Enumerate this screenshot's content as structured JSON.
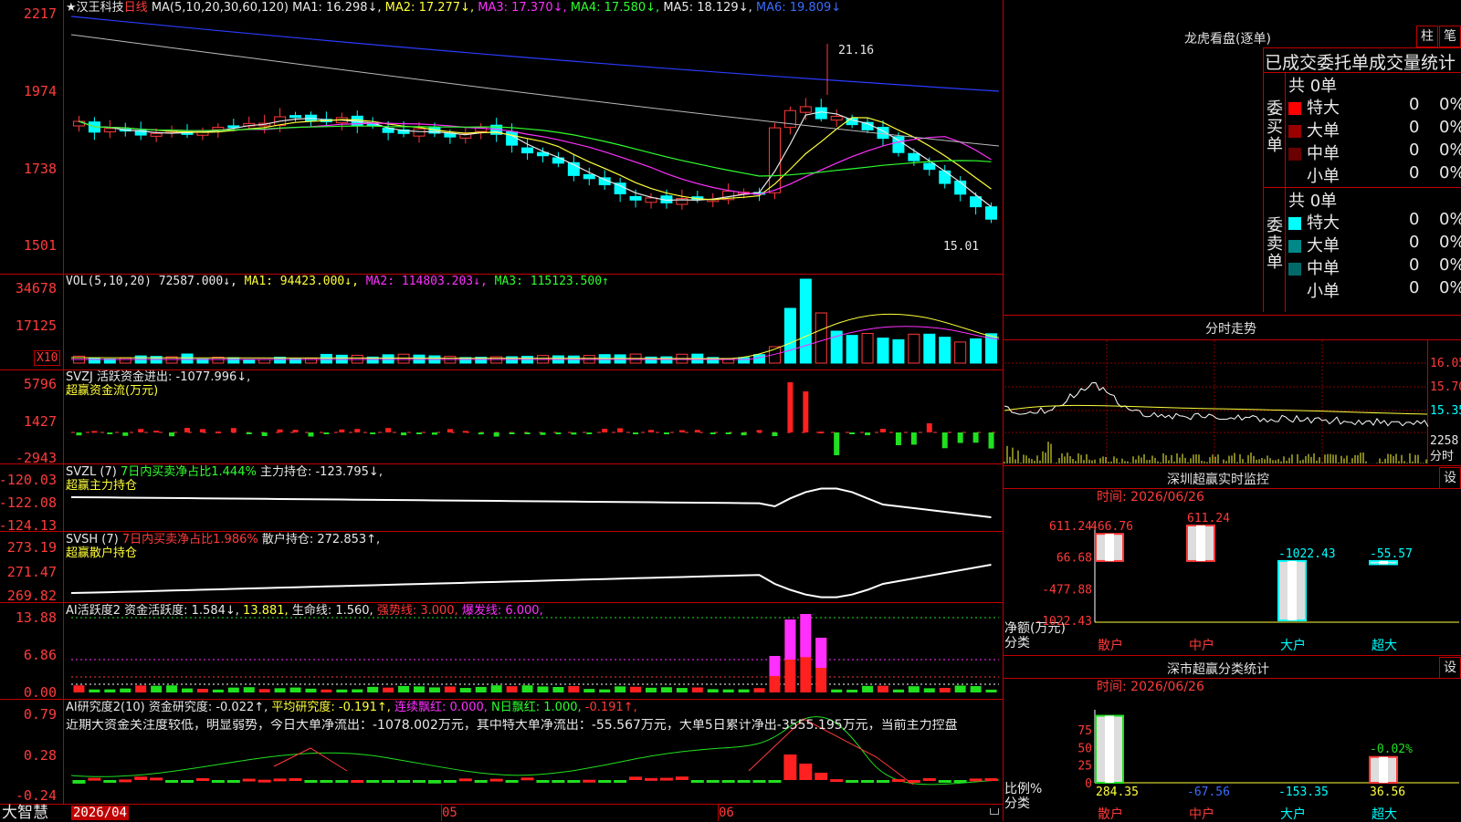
{
  "header": {
    "stock_name": "★汉王科技",
    "period": "日线",
    "ma_params": "MA(5,10,20,30,60,120)",
    "ma1": "MA1: 16.298↓,",
    "ma2": "MA2: 17.277↓,",
    "ma3": "MA3: 17.370↓,",
    "ma4": "MA4: 17.580↓,",
    "ma5": "MA5: 18.129↓,",
    "ma6": "MA6: 19.809↓"
  },
  "price_axis": [
    "2217",
    "1974",
    "1738",
    "1501"
  ],
  "price_marks": {
    "high": "21.16",
    "low": "15.01"
  },
  "vol": {
    "title": "VOL(5,10,20)",
    "value": "72587.000↓,",
    "ma1": "MA1: 94423.000↓,",
    "ma2": "MA2: 114803.203↓,",
    "ma3": "MA3: 115123.500↑",
    "axis": [
      "34678",
      "17125"
    ],
    "unit": "X10"
  },
  "svzj": {
    "title": "SVZJ",
    "line1": "活跃资金进出: -1077.996↓,",
    "line2": "超赢资金流(万元)",
    "axis": [
      "5796",
      "1427",
      "-2943"
    ]
  },
  "svzl": {
    "title": "SVZL (7)",
    "ratio": "7日内买卖净占比1.444%",
    "hold": "主力持仓: -123.795↓,",
    "line2": "超赢主力持仓",
    "axis": [
      "-120.03",
      "-122.08",
      "-124.13"
    ]
  },
  "svsh": {
    "title": "SVSH (7)",
    "ratio": "7日内买卖净占比1.986%",
    "hold": "散户持仓: 272.853↑,",
    "line2": "超赢散户持仓",
    "axis": [
      "273.19",
      "271.47",
      "269.82"
    ]
  },
  "ai1": {
    "title": "AI活跃度2",
    "act": "资金活跃度: 1.584↓,",
    "val": "13.881,",
    "life": "生命线: 1.560,",
    "strong": "强势线: 3.000,",
    "burst": "爆发线: 6.000,",
    "axis": [
      "13.88",
      "6.86",
      "0.00"
    ]
  },
  "ai2": {
    "title": "AI研究度2(10)",
    "research": "资金研究度: -0.022↑,",
    "avg": "平均研究度: -0.191↑,",
    "red": "连续飘红: 0.000,",
    "nred": "N日飘红: 1.000,",
    "last": "-0.191↑,",
    "comment": "近期大资金关注度较低，明显弱势，今日大单净流出：-1078.002万元，其中特大单净流出：-55.567万元，大单5日累计净出-3555.195万元，当前主力控盘",
    "axis": [
      "0.79",
      "0.28",
      "-0.24"
    ]
  },
  "footer": {
    "brand": "大智慧",
    "date_start": "2026/04",
    "m05": "05",
    "m06": "06"
  },
  "lhb": {
    "title": "龙虎看盘(逐单)",
    "btn_bar": "柱",
    "btn_pen": "笔",
    "head": "已成交委托单成交量统计",
    "buy_label": "委买单",
    "sell_label": "委卖单",
    "buy_total": "共 0单",
    "sell_total": "共 0单",
    "buy_rows": [
      {
        "name": "特大",
        "n": "0",
        "p": "0%",
        "color": "#ff0000"
      },
      {
        "name": "大单",
        "n": "0",
        "p": "0%",
        "color": "#9a0000"
      },
      {
        "name": "中单",
        "n": "0",
        "p": "0%",
        "color": "#6a0000"
      },
      {
        "name": "小单",
        "n": "0",
        "p": "0%",
        "color": "#000000"
      }
    ],
    "sell_rows": [
      {
        "name": "特大",
        "n": "0",
        "p": "0%",
        "color": "#00ffff"
      },
      {
        "name": "大单",
        "n": "0",
        "p": "0%",
        "color": "#008888"
      },
      {
        "name": "中单",
        "n": "0",
        "p": "0%",
        "color": "#006a6a"
      },
      {
        "name": "小单",
        "n": "0",
        "p": "0%",
        "color": "#000000"
      }
    ]
  },
  "intraday": {
    "title": "分时走势",
    "axis": [
      "16.05",
      "15.70",
      "15.35"
    ],
    "vol_label": "2258",
    "foot": "分时"
  },
  "monitor": {
    "title": "深圳超赢实时监控",
    "btn": "设",
    "time": "时间: 2026/06/26",
    "ylabel": "净额(万元)",
    "xlabel": "分类",
    "axis": [
      "611.24",
      "66.68",
      "-477.88",
      "-1022.43"
    ],
    "categories": [
      "散户",
      "中户",
      "大户",
      "超大"
    ],
    "labels": [
      "466.76",
      "611.24",
      "-1022.43",
      "-55.57"
    ]
  },
  "classify": {
    "title": "深市超赢分类统计",
    "btn": "设",
    "time": "时间: 2026/06/26",
    "ylabel": "比例%",
    "xlabel": "分类",
    "axis": [
      "75",
      "50",
      "25",
      "0"
    ],
    "categories": [
      "散户",
      "中户",
      "大户",
      "超大"
    ],
    "labels": [
      "284.35",
      "-67.56",
      "-153.35",
      "36.56"
    ],
    "top_label": "-0.02%"
  },
  "chart_data": [
    {
      "type": "bar",
      "title": "深圳超赢实时监控",
      "ylabel": "净额(万元)",
      "xlabel": "分类",
      "categories": [
        "散户",
        "中户",
        "大户",
        "超大"
      ],
      "values": [
        466.76,
        611.24,
        -1022.43,
        -55.57
      ],
      "ylim": [
        -1022.43,
        611.24
      ]
    },
    {
      "type": "bar",
      "title": "深市超赢分类统计",
      "ylabel": "比例%",
      "xlabel": "分类",
      "categories": [
        "散户",
        "中户",
        "大户",
        "超大"
      ],
      "values": [
        284.35,
        -67.56,
        -153.35,
        36.56
      ],
      "ylim": [
        0,
        75
      ]
    },
    {
      "type": "line",
      "title": "★汉王科技 日线",
      "y_ticks": [
        "2217",
        "1974",
        "1738",
        "1501"
      ],
      "annotations": [
        "21.16",
        "15.01"
      ],
      "series": [
        {
          "name": "MA1",
          "last": 16.298
        },
        {
          "name": "MA2",
          "last": 17.277
        },
        {
          "name": "MA3",
          "last": 17.37
        },
        {
          "name": "MA4",
          "last": 17.58
        },
        {
          "name": "MA5",
          "last": 18.129
        },
        {
          "name": "MA6",
          "last": 19.809
        }
      ]
    }
  ]
}
